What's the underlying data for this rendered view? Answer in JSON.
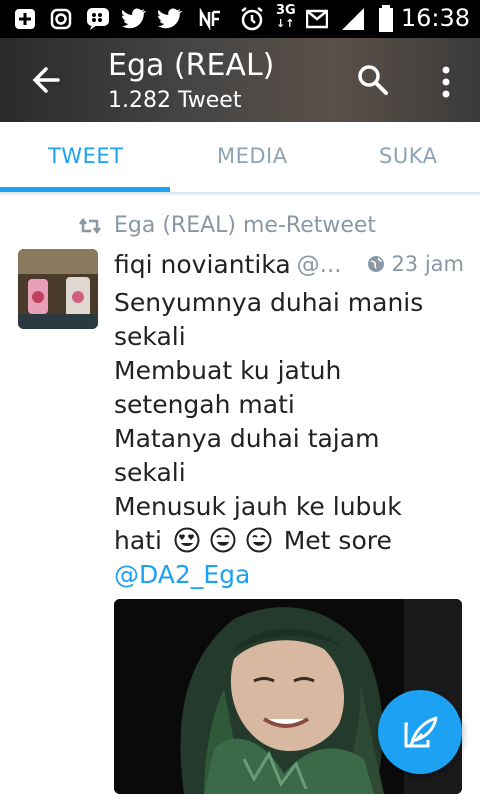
{
  "status_bar": {
    "time": "16:38",
    "network": "3G",
    "icons": [
      "add-box-icon",
      "instagram-icon",
      "bbm-icon",
      "twitter-icon",
      "twitter-icon",
      "nfc-icon",
      "alarm-icon",
      "network-3g-icon",
      "sms-icon",
      "signal-icon",
      "battery-icon"
    ]
  },
  "header": {
    "title": "Ega (REAL)",
    "subtitle": "1.282 Tweet"
  },
  "tabs": [
    {
      "label": "TWEET",
      "active": true
    },
    {
      "label": "MEDIA",
      "active": false
    },
    {
      "label": "SUKA",
      "active": false
    }
  ],
  "tweet": {
    "retweet_label": "Ega (REAL) me-Retweet",
    "author_name": "fiqi noviantika",
    "author_handle": "@...",
    "time": "23 jam",
    "text_lines": [
      "Senyumnya duhai manis",
      "sekali",
      "Membuat ku jatuh",
      "setengah mati",
      "Matanya duhai tajam",
      "sekali",
      "Menusuk jauh ke lubuk"
    ],
    "last_line_start": "hati",
    "last_line_end": "Met sore",
    "mention": "@DA2_Ega"
  },
  "colors": {
    "accent": "#1da1f2",
    "muted": "#8a98a5",
    "text": "#222222"
  }
}
